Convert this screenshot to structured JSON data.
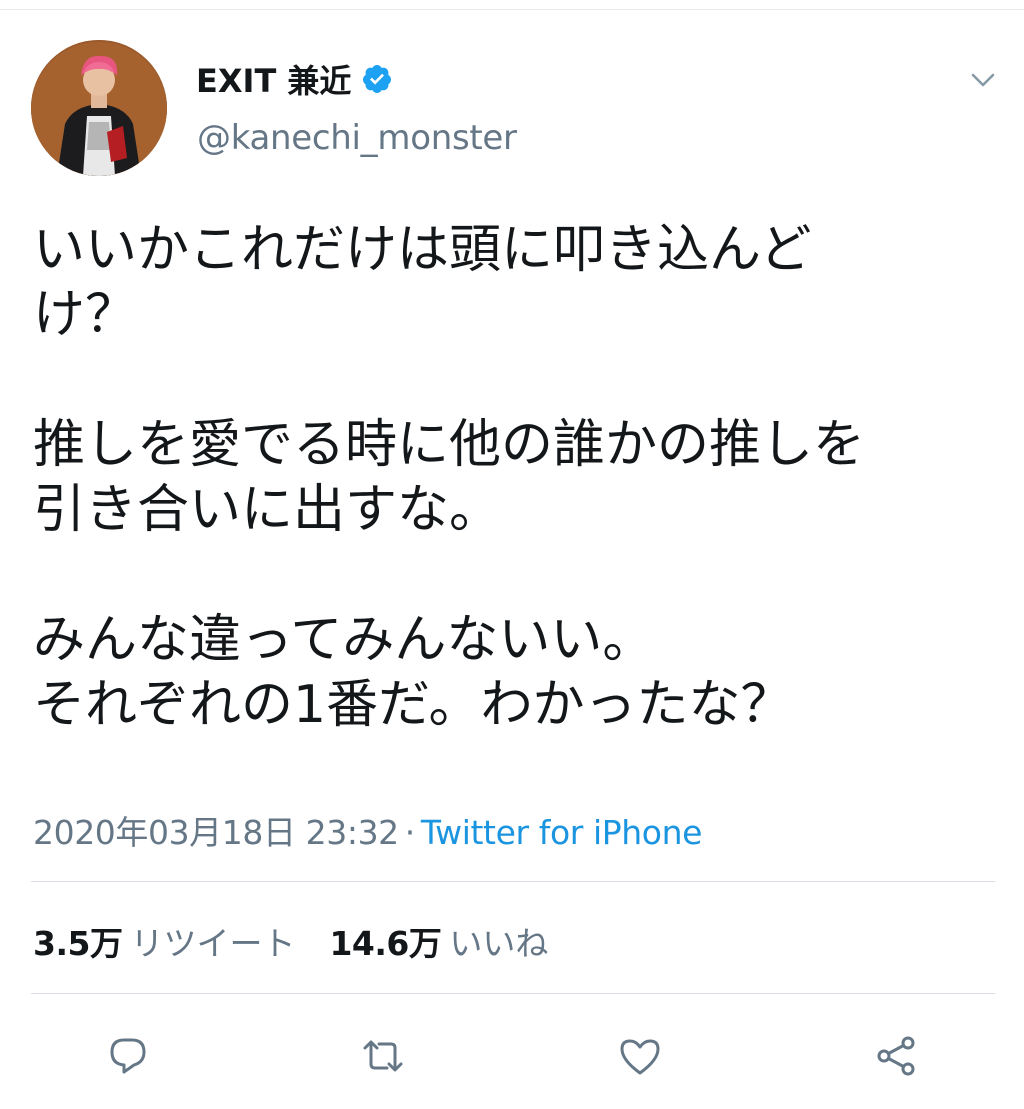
{
  "tweet": {
    "author": {
      "display_name": "EXIT 兼近",
      "handle": "@kanechi_monster",
      "verified": true
    },
    "text_lines": [
      "いいかこれだけは頭に叩き込んど",
      "け？",
      "",
      "推しを愛でる時に他の誰かの推しを",
      "引き合いに出すな。",
      "",
      "みんな違ってみんないい。",
      "それぞれの1番だ。わかったな？"
    ],
    "timestamp": "2020年03月18日 23:32",
    "separator": "·",
    "source": "Twitter for iPhone",
    "stats": {
      "retweets_count": "3.5万",
      "retweets_label": "リツイート",
      "likes_count": "14.6万",
      "likes_label": "いいね"
    }
  },
  "icons": {
    "verified": "verified-badge-icon",
    "caret": "chevron-down-icon",
    "reply": "reply-icon",
    "retweet": "retweet-icon",
    "like": "heart-icon",
    "share": "share-icon"
  },
  "colors": {
    "text": "#14171a",
    "secondary": "#657786",
    "link": "#1b95e0",
    "verified": "#1da1f2",
    "divider": "#e6ecf0"
  }
}
